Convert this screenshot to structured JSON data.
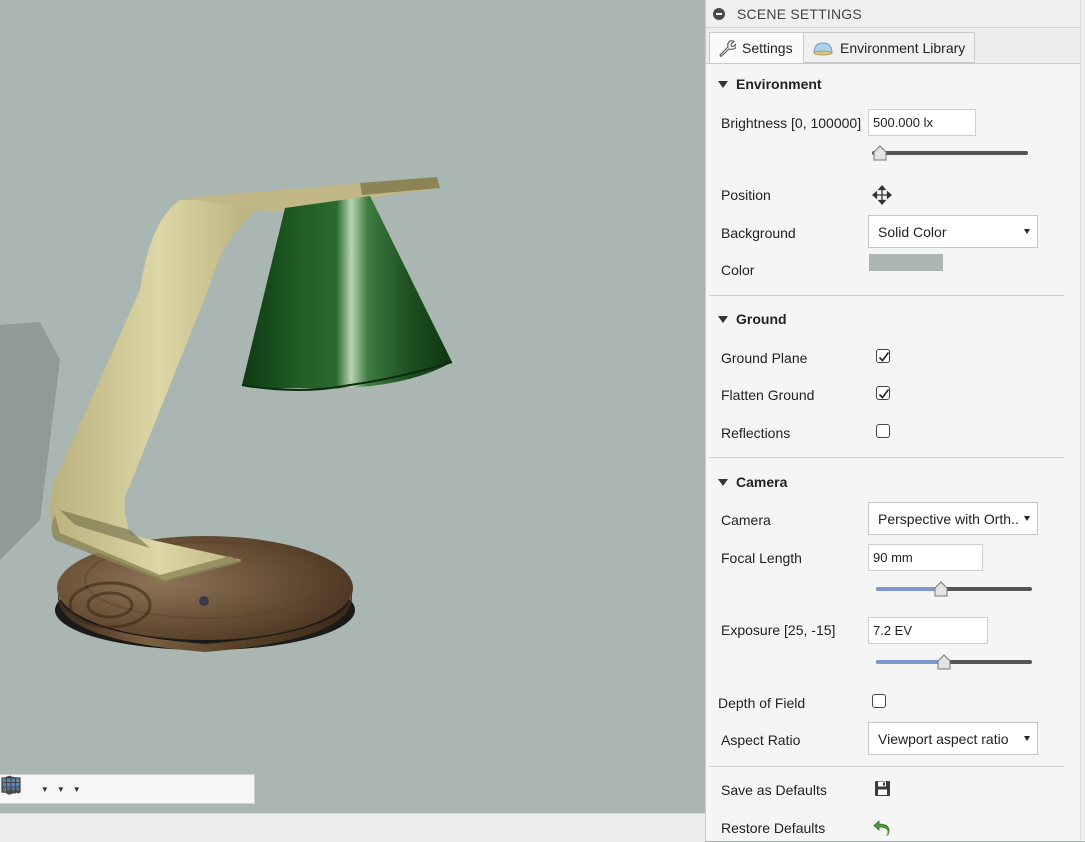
{
  "panel": {
    "title": "SCENE SETTINGS",
    "tabs": [
      {
        "label": "Settings",
        "icon": "wrench-icon",
        "active": true
      },
      {
        "label": "Environment Library",
        "icon": "environment-dome-icon",
        "active": false
      }
    ],
    "environment": {
      "title": "Environment",
      "brightness": {
        "label": "Brightness [0, 100000]",
        "value": "500.000 lx",
        "slider_fraction": 0.005
      },
      "position": {
        "label": "Position",
        "icon": "move-arrows-icon"
      },
      "background": {
        "label": "Background",
        "value": "Solid Color"
      },
      "color": {
        "label": "Color",
        "value_hex": "#a9b6b2"
      }
    },
    "ground": {
      "title": "Ground",
      "ground_plane": {
        "label": "Ground Plane",
        "checked": true
      },
      "flatten_ground": {
        "label": "Flatten Ground",
        "checked": true
      },
      "reflections": {
        "label": "Reflections",
        "checked": false
      }
    },
    "camera": {
      "title": "Camera",
      "camera": {
        "label": "Camera",
        "value": "Perspective with Orth..."
      },
      "focal_length": {
        "label": "Focal Length",
        "value": "90 mm",
        "slider_fraction": 0.41
      },
      "exposure": {
        "label": "Exposure [25, -15]",
        "value": "7.2 EV",
        "slider_fraction": 0.43
      },
      "depth_of_field": {
        "label": "Depth of Field",
        "checked": false
      },
      "aspect_ratio": {
        "label": "Aspect Ratio",
        "value": "Viewport aspect ratio"
      }
    },
    "actions": {
      "save_defaults": {
        "label": "Save as Defaults",
        "icon": "floppy-disk-icon"
      },
      "restore_defaults": {
        "label": "Restore Defaults",
        "icon": "undo-arrow-icon"
      }
    }
  },
  "nav_toolbar": {
    "items": [
      "orbit-icon",
      "look-at-icon",
      "pan-hand-icon",
      "zoom-icon",
      "zoom-window-icon",
      "display-settings-icon",
      "grid-icon"
    ]
  },
  "colors": {
    "viewport_bg": "#a9b6b2",
    "slider_fill": "#7d98cf",
    "lamp_shade": "#1e4a1e",
    "lamp_arm": "#cdc493",
    "lamp_base": "#6b5238"
  }
}
